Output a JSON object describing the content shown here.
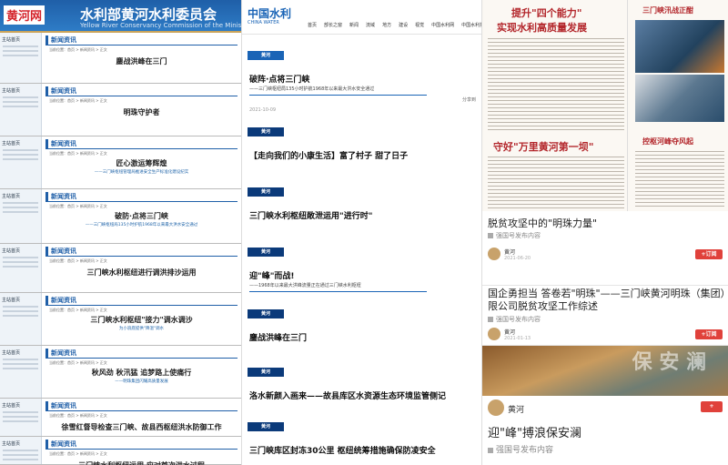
{
  "left": {
    "logo": "黄河网",
    "banner_title": "水利部黄河水利委员会",
    "banner_sub": "Yellow River Conservancy Commission of the Ministry of Water Resources",
    "section_label": "新闻资讯",
    "side_heading": "主站首页",
    "crumb": "当前位置：首页 > 新闻资讯 > 正文",
    "articles": [
      {
        "title": "鏖战洪峰在三门",
        "sub": ""
      },
      {
        "title": "明珠守护者",
        "sub": ""
      },
      {
        "title": "匠心激运筹辉煌",
        "sub": "——三门峡枢纽管理局推进安全生产标准化建设纪实"
      },
      {
        "title": "破防·点将三门峡",
        "sub": "——三门峡枢纽局135小时护航1968年以来最大洪水安全通过"
      },
      {
        "title": "三门峡水利枢纽进行调洪排沙运用",
        "sub": ""
      },
      {
        "title": "三门峡水利枢纽\"接力\"调水调沙",
        "sub": "为小浪底提供\"降温\"调水"
      },
      {
        "title": "秋风劲 秋汛猛 追梦路上使痛行",
        "sub": "——明珠集团闪耀高质量发展"
      },
      {
        "title": "徐雪红督导检查三门峡、故县西枢纽洪水防御工作",
        "sub": ""
      },
      {
        "title": "三门峡水利枢纽运用 应对首次洪水过程",
        "sub": ""
      }
    ]
  },
  "middle": {
    "logo": "中国水利",
    "logo_sub": "CHINA WATER",
    "nav": [
      "首页",
      "部长之窗",
      "新闻",
      "流域",
      "地方",
      "建设",
      "视觉",
      "中国水利网",
      "中国水利报"
    ],
    "tag": "黄河",
    "share": "分享到",
    "items": [
      {
        "title": "破阵·点将三门峡",
        "sub": "——三门峡枢纽局135小时护航1968年以来最大洪水安全通过",
        "date": "2021-10-09"
      },
      {
        "title": "【走向我们的小康生活】富了村子 甜了日子",
        "sub": "",
        "date": ""
      },
      {
        "title": "三门峡水利枢纽敞泄运用\"进行时\"",
        "sub": "",
        "date": ""
      },
      {
        "title": "迎\"峰\"而战!",
        "sub": "——1968年以来最大洪峰流量正在通过三门峡水利枢纽",
        "date": ""
      },
      {
        "title": "鏖战洪峰在三门",
        "sub": "",
        "date": ""
      },
      {
        "title": "洛水新颜入画来——故县库区水资源生态环境监管侧记",
        "sub": "",
        "date": ""
      },
      {
        "title": "三门峡库区封冻30公里 枢纽统筹措施确保防凌安全",
        "sub": "",
        "date": ""
      }
    ]
  },
  "right": {
    "np_head1": "提升\"四个能力\"",
    "np_head2": "实现水利高质量发展",
    "np_head3": "守好\"万里黄河第一坝\"",
    "np_head4": "三门峡汛战正酣",
    "np_head5": "控枢河峰夺风起",
    "cards": [
      {
        "title": "脱贫攻坚中的\"明珠力量\"",
        "meta": "强国号发布内容",
        "author": "黄河",
        "date": "2021-06-20",
        "follow": "+订阅"
      },
      {
        "title": "国企勇担当 答卷若\"明珠\"——三门峡黄河明珠（集团）有",
        "title2": "限公司脱贫攻坚工作综述",
        "meta": "强国号发布内容",
        "author": "黄河",
        "date": "2021-01-13",
        "follow": "+订阅"
      },
      {
        "title": "迎\"峰\"搏浪保安澜",
        "meta": "强国号发布内容",
        "author": "黄河",
        "follow": "+"
      }
    ],
    "photo_caption": "保 安 澜"
  }
}
